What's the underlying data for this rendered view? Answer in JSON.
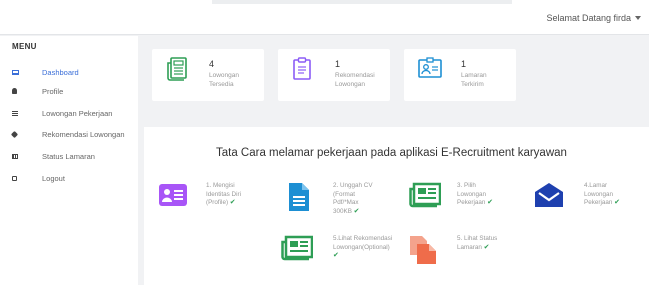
{
  "header": {
    "greeting": "Selamat Datang firda"
  },
  "sidebar": {
    "menu_title": "MENU",
    "items": [
      {
        "label": "Dashboard",
        "icon": "laptop-icon",
        "active": true
      },
      {
        "label": "Profile",
        "icon": "user-icon"
      },
      {
        "label": "Lowongan Pekerjaan",
        "icon": "list-icon"
      },
      {
        "label": "Rekomendasi Lowongan",
        "icon": "tag-icon"
      },
      {
        "label": "Status Lamaran",
        "icon": "table-icon"
      },
      {
        "label": "Logout",
        "icon": "logout-icon"
      }
    ]
  },
  "cards": [
    {
      "number": "4",
      "label": "Lowongan Tersedia",
      "icon": "newspaper-icon",
      "color": "#2e9e55"
    },
    {
      "number": "1",
      "label": "Rekomendasi Lowongan",
      "icon": "clipboard-icon",
      "color": "#8b5cf6"
    },
    {
      "number": "1",
      "label": "Lamaran Terkirim",
      "icon": "id-card-icon",
      "color": "#1d8fd3"
    }
  ],
  "guide": {
    "title": "Tata Cara melamar pekerjaan pada aplikasi E-Recruitment karyawan",
    "steps": [
      {
        "text": "1. Mengisi Identitas Diri (Profile)",
        "check": "✔",
        "icon": "address-card-icon",
        "color": "#a855f7"
      },
      {
        "text": "2. Unggah CV (Format Pdf/*Max 300KB",
        "check": "✔",
        "icon": "file-icon",
        "color": "#1d8fd3"
      },
      {
        "text": "3. Pilih Lowongan Pekerjaan",
        "check": "✔",
        "icon": "newspaper-icon",
        "color": "#2e9e55"
      },
      {
        "text": "4.Lamar Lowongan Pekerjaan",
        "check": "✔",
        "icon": "envelope-icon",
        "color": "#1e40af"
      },
      {
        "text": "5.Lihat Rekomendasi Lowongan(Optional)",
        "check": "✔",
        "icon": "newspaper-icon",
        "color": "#2e9e55"
      },
      {
        "text": "5. Lihat Status Lamaran",
        "check": "✔",
        "icon": "copy-icon",
        "color": "#ef6c4a"
      }
    ]
  }
}
